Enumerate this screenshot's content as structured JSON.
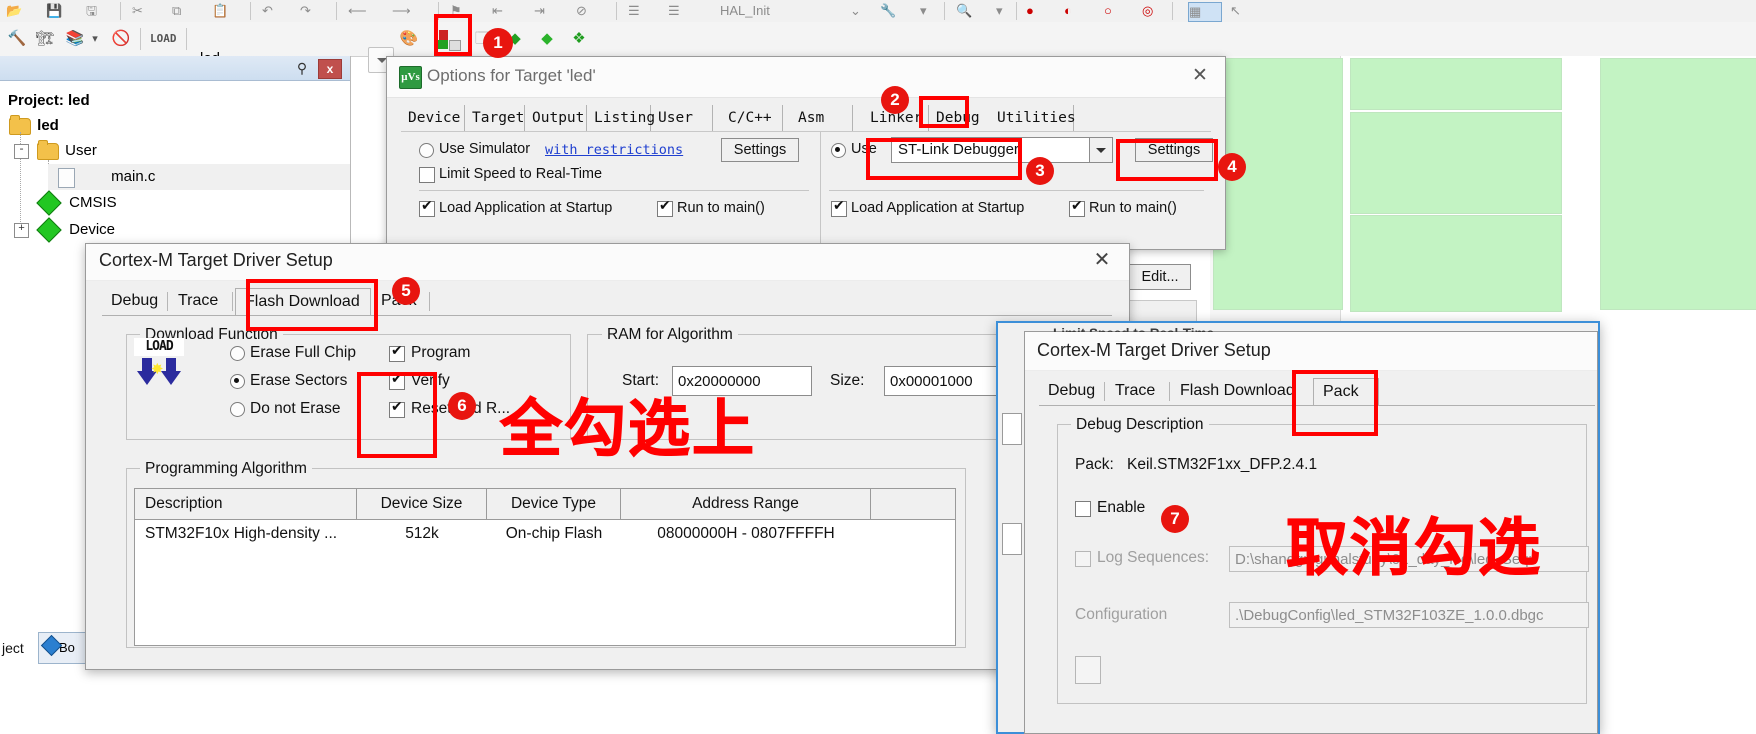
{
  "app": {
    "toolbar": {
      "target_name": "led"
    },
    "project_pane": {
      "title_label": "Project: led",
      "pin_icon": "pin-icon",
      "close_label": "x",
      "tree": [
        {
          "label": "led",
          "icon": "folder-icon",
          "depth": 0,
          "expander": ""
        },
        {
          "label": "User",
          "icon": "folder-icon",
          "depth": 1,
          "expander": "-"
        },
        {
          "label": "main.c",
          "icon": "file-icon",
          "depth": 2,
          "expander": ""
        },
        {
          "label": "CMSIS",
          "icon": "diamond-icon",
          "depth": 1,
          "expander": ""
        },
        {
          "label": "Device",
          "icon": "diamond-icon",
          "depth": 1,
          "expander": "+"
        }
      ],
      "bottom_tab": "Bo"
    },
    "status_left": "ject"
  },
  "options_dialog": {
    "title": "Options for Target 'led'",
    "logo_text": "μVs",
    "close_icon": "close-icon",
    "tabs": [
      "Device",
      "Target",
      "Output",
      "Listing",
      "User",
      "C/C++",
      "Asm",
      "Linker",
      "Debug",
      "Utilities"
    ],
    "selected_tab": "Debug",
    "left": {
      "use_simulator_label": "Use Simulator",
      "use_simulator_checked": false,
      "with_restrictions_link": "with restrictions",
      "settings_label": "Settings",
      "limit_speed_label": "Limit Speed to Real-Time",
      "limit_speed_checked": false,
      "load_app_label": "Load Application at Startup",
      "load_app_checked": true,
      "run_to_main_label": "Run to main()",
      "run_to_main_checked": true
    },
    "right": {
      "use_label": "Use",
      "use_checked": true,
      "debugger_value": "ST-Link Debugger",
      "settings_label": "Settings",
      "load_app_label": "Load Application at Startup",
      "load_app_checked": true,
      "run_to_main_label": "Run to main()",
      "run_to_main_checked": true,
      "edit_label": "Edit..."
    }
  },
  "cortex_flash_dialog": {
    "title": "Cortex-M Target Driver Setup",
    "close_icon": "close-icon",
    "tabs": [
      "Debug",
      "Trace",
      "Flash Download",
      "Pack"
    ],
    "selected_tab": "Flash Download",
    "download_function": {
      "caption": "Download Function",
      "load_icon_text": "LOAD",
      "radios": [
        {
          "label": "Erase Full Chip",
          "checked": false
        },
        {
          "label": "Erase Sectors",
          "checked": true
        },
        {
          "label": "Do not Erase",
          "checked": false
        }
      ],
      "checks": [
        {
          "label": "Program",
          "checked": true
        },
        {
          "label": "Verify",
          "checked": true
        },
        {
          "label": "Reset and R...",
          "checked": true
        }
      ]
    },
    "ram_for_algorithm": {
      "caption": "RAM for Algorithm",
      "start_label": "Start:",
      "start_value": "0x20000000",
      "size_label": "Size:",
      "size_value": "0x00001000"
    },
    "programming_algorithm": {
      "caption": "Programming Algorithm",
      "columns": [
        "Description",
        "Device Size",
        "Device Type",
        "Address Range"
      ],
      "rows": [
        [
          "STM32F10x High-density ...",
          "512k",
          "On-chip Flash",
          "08000000H - 0807FFFFH"
        ]
      ]
    }
  },
  "cortex_pack_dialog": {
    "title": "Cortex-M Target Driver Setup",
    "tabs": [
      "Debug",
      "Trace",
      "Flash Download",
      "Pack"
    ],
    "selected_tab": "Pack",
    "debug_description": {
      "caption": "Debug Description",
      "pack_label": "Pack:",
      "pack_value": "Keil.STM32F1xx_DFP.2.4.1",
      "enable_label": "Enable",
      "enable_checked": false,
      "log_sequences_label": "Log Sequences:",
      "log_sequences_checked": false,
      "log_sequences_value": "D:\\shangguiguhalstudy\\01_day_led\\led_Sequ",
      "configuration_label": "Configuration",
      "configuration_value": ".\\DebugConfig\\led_STM32F103ZE_1.0.0.dbgc"
    }
  },
  "ghost_labels": {
    "limit_speed": "Limit Speed to Real-Time"
  },
  "annotations": {
    "color": "#ff0000",
    "markers": [
      {
        "id": "1",
        "target": "options-toolbar-button"
      },
      {
        "id": "2",
        "target": "debug-tab"
      },
      {
        "id": "3",
        "target": "debugger-combo"
      },
      {
        "id": "4",
        "target": "settings-button-right"
      },
      {
        "id": "5",
        "target": "flash-download-tab"
      },
      {
        "id": "6",
        "target": "download-checkboxes"
      },
      {
        "id": "7",
        "target": "enable-checkbox"
      }
    ],
    "notes": [
      {
        "text": "全勾选上",
        "meaning": "check-all-note"
      },
      {
        "text": "取消勾选",
        "meaning": "uncheck-note"
      }
    ]
  }
}
